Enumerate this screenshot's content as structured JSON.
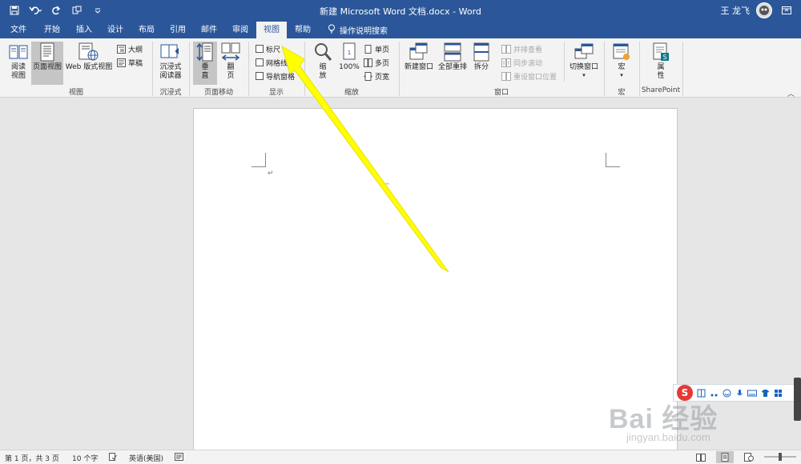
{
  "window": {
    "title": "新建 Microsoft Word 文档.docx  -  Word",
    "user": "王 龙飞"
  },
  "tabs": [
    {
      "label": "文件",
      "active": false
    },
    {
      "label": "开始",
      "active": false
    },
    {
      "label": "插入",
      "active": false
    },
    {
      "label": "设计",
      "active": false
    },
    {
      "label": "布局",
      "active": false
    },
    {
      "label": "引用",
      "active": false
    },
    {
      "label": "邮件",
      "active": false
    },
    {
      "label": "审阅",
      "active": false
    },
    {
      "label": "视图",
      "active": true
    },
    {
      "label": "帮助",
      "active": false
    }
  ],
  "tell_me": "操作说明搜索",
  "ribbon": {
    "views": {
      "read_mode": "阅读\n视图",
      "print_layout": "页面视图",
      "web_layout": "Web 版式视图",
      "outline": "大纲",
      "draft": "草稿",
      "group": "视图"
    },
    "immersive": {
      "reader": "沉浸式\n阅读器",
      "group": "沉浸式"
    },
    "page_movement": {
      "vertical": "垂\n直",
      "side_to_side": "翻\n页",
      "group": "页面移动"
    },
    "show": {
      "ruler": "标尺",
      "gridlines": "网格线",
      "nav_pane": "导航窗格",
      "group": "显示"
    },
    "zoom": {
      "zoom": "缩\n放",
      "hundred": "100%",
      "one_page": "单页",
      "multi_page": "多页",
      "page_width": "页宽",
      "group": "缩放"
    },
    "window": {
      "new_window": "新建窗口",
      "arrange_all": "全部重排",
      "split": "拆分",
      "side_by_side": "并排查看",
      "sync_scroll": "同步滚动",
      "reset_pos": "重设窗口位置",
      "switch": "切换窗口",
      "group": "窗口"
    },
    "macros": {
      "macros": "宏",
      "group": "宏"
    },
    "sharepoint": {
      "properties": "属\n性",
      "group": "SharePoint"
    }
  },
  "document": {
    "para_mark": "↵",
    "anchor": "⌐"
  },
  "status": {
    "page": "第 1 页，共 3 页",
    "words": "10 个字",
    "language": "英语(美国)"
  },
  "watermark": {
    "main": "Bai  经验",
    "sub": "jingyan.baidu.com"
  },
  "ime": {
    "logo": "S"
  },
  "colors": {
    "titlebar": "#2b579a",
    "ribbon": "#f3f3f3",
    "annotation_arrow": "#ffff00"
  }
}
